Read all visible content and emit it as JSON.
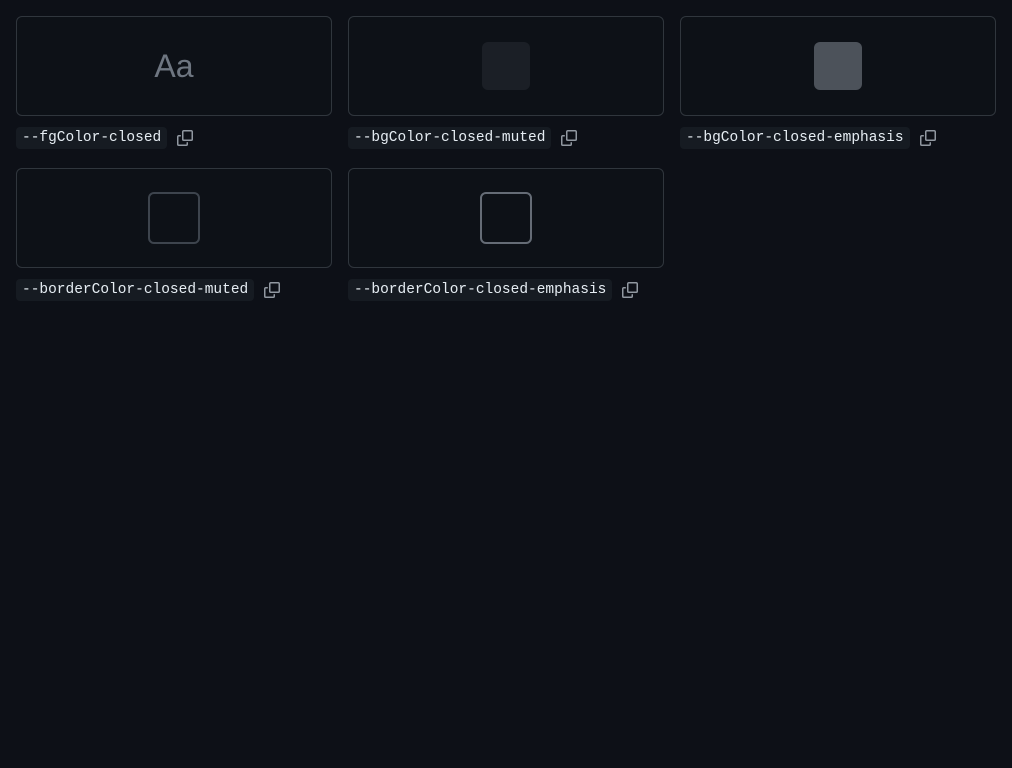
{
  "tokens": [
    {
      "name": "--fgColor-closed",
      "kind": "text",
      "sample": "Aa",
      "color": "#6e7681"
    },
    {
      "name": "--bgColor-closed-muted",
      "kind": "fill",
      "color": "#1b1f26"
    },
    {
      "name": "--bgColor-closed-emphasis",
      "kind": "fill",
      "color": "#4c525a"
    },
    {
      "name": "--borderColor-closed-muted",
      "kind": "border",
      "color": "#3d444d"
    },
    {
      "name": "--borderColor-closed-emphasis",
      "kind": "border",
      "color": "#656c76"
    }
  ],
  "icons": {
    "copy": "copy-icon"
  },
  "colors": {
    "page_background": "#0d1017",
    "card_border": "#30363d",
    "label_background": "#161b22",
    "label_text": "#e6edf3",
    "icon": "#9198a1"
  }
}
